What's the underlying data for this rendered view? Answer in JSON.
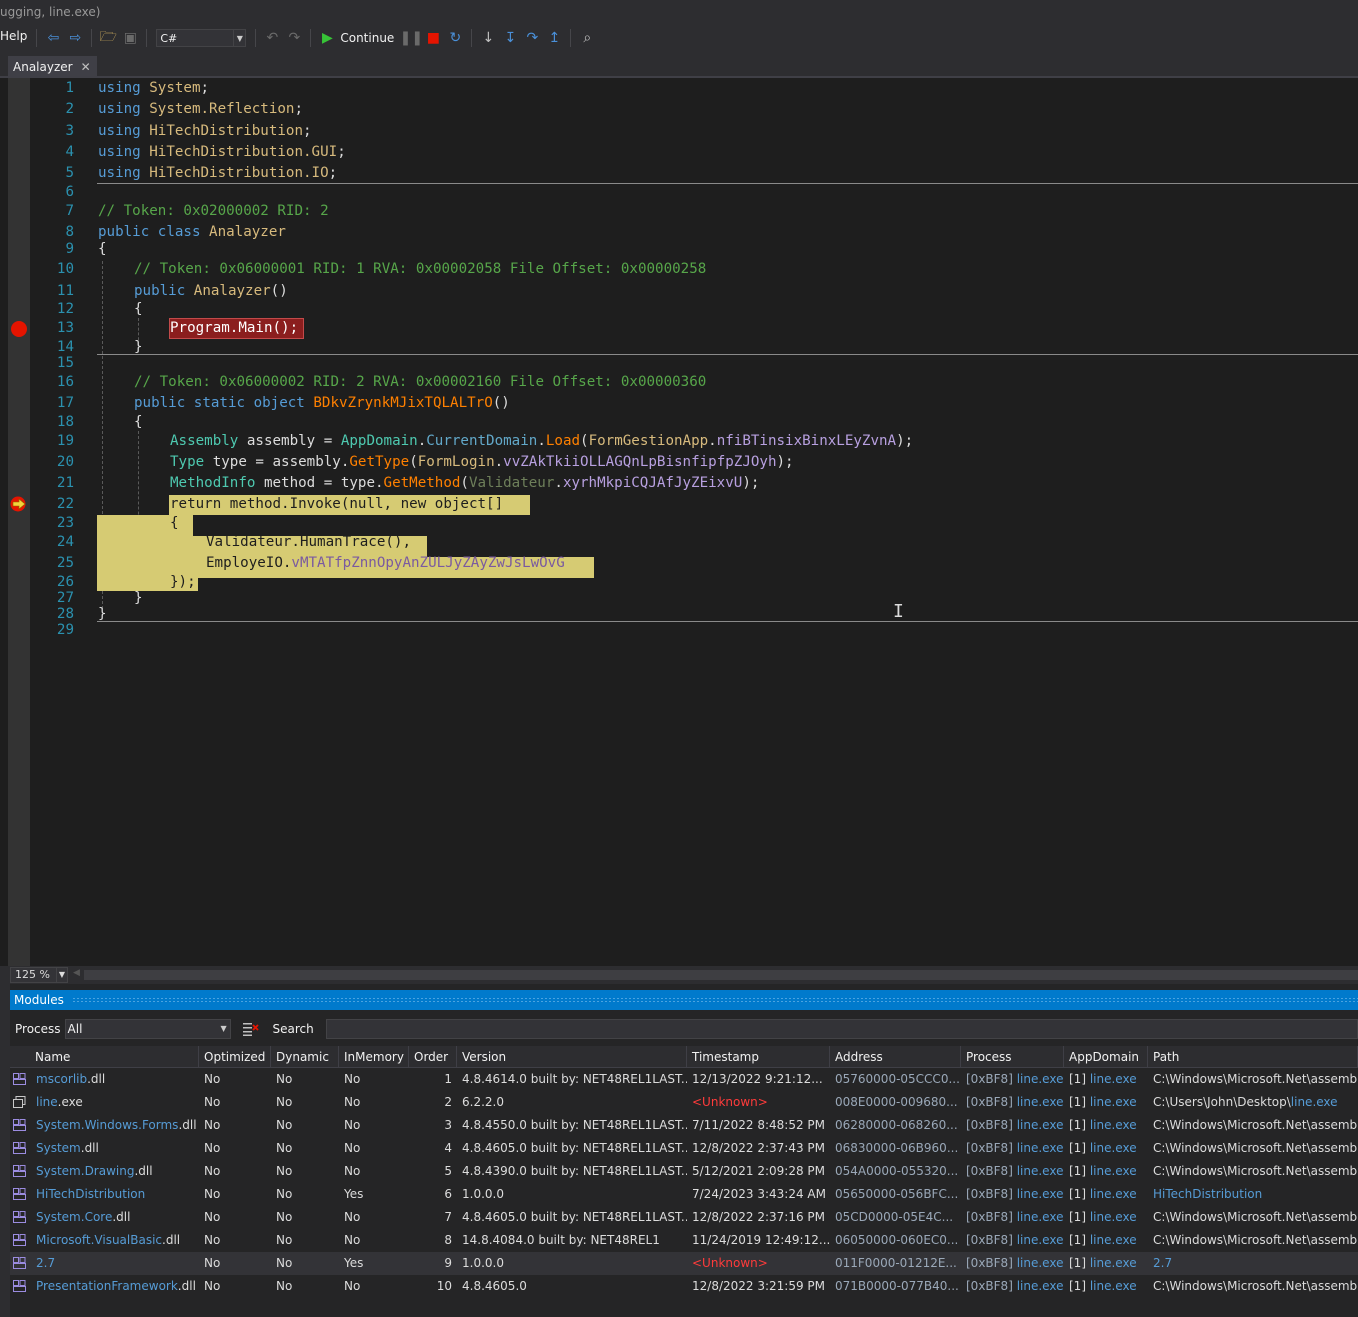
{
  "window": {
    "title": "ugging, line.exe)"
  },
  "toolbar": {
    "help_label": "Help",
    "language_value": "C#",
    "continue_label": "Continue",
    "icons": [
      "back-icon",
      "forward-icon",
      "open-icon",
      "save-icon",
      "undo-icon",
      "redo-icon",
      "play-icon",
      "pause-icon",
      "stop-icon",
      "restart-icon",
      "step-into-icon",
      "step-into-alt-icon",
      "step-over-icon",
      "step-out-icon",
      "search-icon"
    ]
  },
  "tab": {
    "label": "Analayzer",
    "close": "✕"
  },
  "editor": {
    "line_numbers": [
      "1",
      "2",
      "3",
      "4",
      "5",
      "6",
      "7",
      "8",
      "9",
      "10",
      "11",
      "12",
      "13",
      "14",
      "15",
      "16",
      "17",
      "18",
      "19",
      "20",
      "21",
      "22",
      "23",
      "24",
      "25",
      "26",
      "27",
      "28",
      "29"
    ],
    "breakpoint_line": 13,
    "current_line": 22,
    "code": {
      "l1_kw": "using",
      "l1_ns": "System",
      "l1_end": ";",
      "l2_kw": "using",
      "l2_ns": "System.Reflection",
      "l2_end": ";",
      "l3_kw": "using",
      "l3_ns": "HiTechDistribution",
      "l3_end": ";",
      "l4_kw": "using",
      "l4_ns": "HiTechDistribution.GUI",
      "l4_end": ";",
      "l5_kw": "using",
      "l5_ns": "HiTechDistribution.IO",
      "l5_end": ";",
      "l7_cm": "// Token: 0x02000002 RID: 2",
      "l8_kw": "public class",
      "l8_cl": "Analayzer",
      "l9": "{",
      "l10_cm": "// Token: 0x06000001 RID: 1 RVA: 0x00002058 File Offset: 0x00000258",
      "l11_kw": "public",
      "l11_cl": "Analayzer",
      "l11_end": "()",
      "l12": "{",
      "l13": "Program.Main();",
      "l14": "}",
      "l16_cm": "// Token: 0x06000002 RID: 2 RVA: 0x00002160 File Offset: 0x00000360",
      "l17_kw": "public static object",
      "l17_mt": "BDkvZrynkMJixTQLALTrO",
      "l17_end": "()",
      "l18": "{",
      "l19_ty": "Assembly",
      "l19_va": " assembly = ",
      "l19_cl": "AppDomain",
      "l19_dot1": ".",
      "l19_pr": "CurrentDomain",
      "l19_dot2": ".",
      "l19_mt": "Load",
      "l19_p1": "(",
      "l19_cl2": "FormGestionApp",
      "l19_dot3": ".",
      "l19_fd": "nfiBTinsixBinxLEyZvnA",
      "l19_end": ");",
      "l20_ty": "Type",
      "l20_va": " type = assembly.",
      "l20_mt": "GetType",
      "l20_p1": "(",
      "l20_cl": "FormLogin",
      "l20_dot": ".",
      "l20_fd": "vvZAkTkiiOLLAGQnLpBisnfipfpZJOyh",
      "l20_end": ");",
      "l21_ty": "MethodInfo",
      "l21_va": " method = type.",
      "l21_mt": "GetMethod",
      "l21_p1": "(",
      "l21_cl": "Validateur",
      "l21_dot": ".",
      "l21_fd": "xyrhMkpiCQJAfJyZEixvU",
      "l21_end": ");",
      "l22": "return method.Invoke(null, new object[]",
      "l23": "{",
      "l24": "Validateur.HumanTrace(),",
      "l25_a": "EmployeIO.",
      "l25_b": "vMTATfpZnnOpyAnZULJyZAyZwJsLwOvG",
      "l26": "});",
      "l27": "}",
      "l28": "}"
    }
  },
  "zoom": {
    "value": "125 %"
  },
  "modules": {
    "title": "Modules",
    "process_label": "Process",
    "process_value": "All",
    "search_label": "Search",
    "search_value": "",
    "columns": [
      "Name",
      "Optimized",
      "Dynamic",
      "InMemory",
      "Order",
      "Version",
      "Timestamp",
      "Address",
      "Process",
      "AppDomain",
      "Path"
    ],
    "rows": [
      {
        "name_link": "mscorlib",
        "name_ext": ".dll",
        "optimized": "No",
        "dynamic": "No",
        "inmemory": "No",
        "order": "1",
        "version": "4.8.4614.0 built by: NET48REL1LAST...",
        "timestamp": "12/13/2022 9:21:12...",
        "ts_unknown": false,
        "address": "05760000-05CCC0...",
        "proc_id": "[0xBF8] ",
        "proc_link": "line.exe",
        "ad_id": "[1] ",
        "ad_link": "line.exe",
        "path_pre": "C:\\Windows\\Microsoft.Net\\assemb",
        "path_link": "",
        "path_is_link": false
      },
      {
        "name_link": "line",
        "name_ext": ".exe",
        "optimized": "No",
        "dynamic": "No",
        "inmemory": "No",
        "order": "2",
        "version": "6.2.2.0",
        "timestamp": "<Unknown>",
        "ts_unknown": true,
        "address": "008E0000-009680...",
        "proc_id": "[0xBF8] ",
        "proc_link": "line.exe",
        "ad_id": "[1] ",
        "ad_link": "line.exe",
        "path_pre": "C:\\Users\\John\\Desktop\\",
        "path_link": "line.exe",
        "path_is_link": false
      },
      {
        "name_link": "System.Windows.Forms",
        "name_ext": ".dll",
        "optimized": "No",
        "dynamic": "No",
        "inmemory": "No",
        "order": "3",
        "version": "4.8.4550.0 built by: NET48REL1LAST...",
        "timestamp": "7/11/2022 8:48:52 PM",
        "ts_unknown": false,
        "address": "06280000-068260...",
        "proc_id": "[0xBF8] ",
        "proc_link": "line.exe",
        "ad_id": "[1] ",
        "ad_link": "line.exe",
        "path_pre": "C:\\Windows\\Microsoft.Net\\assemb",
        "path_link": "",
        "path_is_link": false
      },
      {
        "name_link": "System",
        "name_ext": ".dll",
        "optimized": "No",
        "dynamic": "No",
        "inmemory": "No",
        "order": "4",
        "version": "4.8.4605.0 built by: NET48REL1LAST...",
        "timestamp": "12/8/2022 2:37:43 PM",
        "ts_unknown": false,
        "address": "06830000-06B960...",
        "proc_id": "[0xBF8] ",
        "proc_link": "line.exe",
        "ad_id": "[1] ",
        "ad_link": "line.exe",
        "path_pre": "C:\\Windows\\Microsoft.Net\\assemb",
        "path_link": "",
        "path_is_link": false
      },
      {
        "name_link": "System.Drawing",
        "name_ext": ".dll",
        "optimized": "No",
        "dynamic": "No",
        "inmemory": "No",
        "order": "5",
        "version": "4.8.4390.0 built by: NET48REL1LAST...",
        "timestamp": "5/12/2021 2:09:28 PM",
        "ts_unknown": false,
        "address": "054A0000-055320...",
        "proc_id": "[0xBF8] ",
        "proc_link": "line.exe",
        "ad_id": "[1] ",
        "ad_link": "line.exe",
        "path_pre": "C:\\Windows\\Microsoft.Net\\assemb",
        "path_link": "",
        "path_is_link": false
      },
      {
        "name_link": "HiTechDistribution",
        "name_ext": "",
        "optimized": "No",
        "dynamic": "No",
        "inmemory": "Yes",
        "order": "6",
        "version": "1.0.0.0",
        "timestamp": "7/24/2023 3:43:24 AM",
        "ts_unknown": false,
        "address": "05650000-056BFC...",
        "proc_id": "[0xBF8] ",
        "proc_link": "line.exe",
        "ad_id": "[1] ",
        "ad_link": "line.exe",
        "path_pre": "",
        "path_link": "HiTechDistribution",
        "path_is_link": true
      },
      {
        "name_link": "System.Core",
        "name_ext": ".dll",
        "optimized": "No",
        "dynamic": "No",
        "inmemory": "No",
        "order": "7",
        "version": "4.8.4605.0 built by: NET48REL1LAST...",
        "timestamp": "12/8/2022 2:37:16 PM",
        "ts_unknown": false,
        "address": "05CD0000-05E4C...",
        "proc_id": "[0xBF8] ",
        "proc_link": "line.exe",
        "ad_id": "[1] ",
        "ad_link": "line.exe",
        "path_pre": "C:\\Windows\\Microsoft.Net\\assemb",
        "path_link": "",
        "path_is_link": false
      },
      {
        "name_link": "Microsoft.VisualBasic",
        "name_ext": ".dll",
        "optimized": "No",
        "dynamic": "No",
        "inmemory": "No",
        "order": "8",
        "version": "14.8.4084.0 built by: NET48REL1",
        "timestamp": "11/24/2019 12:49:12...",
        "ts_unknown": false,
        "address": "06050000-060EC0...",
        "proc_id": "[0xBF8] ",
        "proc_link": "line.exe",
        "ad_id": "[1] ",
        "ad_link": "line.exe",
        "path_pre": "C:\\Windows\\Microsoft.Net\\assemb",
        "path_link": "",
        "path_is_link": false
      },
      {
        "name_link": "2.7",
        "name_ext": "",
        "optimized": "No",
        "dynamic": "No",
        "inmemory": "Yes",
        "order": "9",
        "version": "1.0.0.0",
        "timestamp": "<Unknown>",
        "ts_unknown": true,
        "address": "011F0000-01212E...",
        "proc_id": "[0xBF8] ",
        "proc_link": "line.exe",
        "ad_id": "[1] ",
        "ad_link": "line.exe",
        "path_pre": "",
        "path_link": "2.7",
        "path_is_link": true
      },
      {
        "name_link": "PresentationFramework",
        "name_ext": ".dll",
        "optimized": "No",
        "dynamic": "No",
        "inmemory": "No",
        "order": "10",
        "version": "4.8.4605.0",
        "timestamp": "12/8/2022 3:21:59 PM",
        "ts_unknown": false,
        "address": "071B0000-077B40...",
        "proc_id": "[0xBF8] ",
        "proc_link": "line.exe",
        "ad_id": "[1] ",
        "ad_link": "line.exe",
        "path_pre": "C:\\Windows\\Microsoft.Net\\assemb",
        "path_link": "",
        "path_is_link": false
      }
    ],
    "selected_row": 8
  }
}
